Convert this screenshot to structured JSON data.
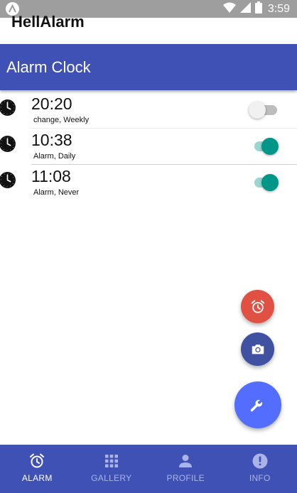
{
  "status_bar": {
    "time": "3:59"
  },
  "app": {
    "title": "HellAlarm"
  },
  "toolbar": {
    "title": "Alarm Clock"
  },
  "alarms": [
    {
      "time": "20:20",
      "detail": "change, Weekly",
      "enabled": false
    },
    {
      "time": "10:38",
      "detail": "Alarm, Daily",
      "enabled": true
    },
    {
      "time": "11:08",
      "detail": "Alarm, Never",
      "enabled": true
    }
  ],
  "fabs": [
    {
      "icon": "alarm-clock-icon",
      "color": "#e05144"
    },
    {
      "icon": "camera-icon",
      "color": "#3f51a0"
    },
    {
      "icon": "wrench-icon",
      "color": "#536dfe"
    }
  ],
  "bottom_nav": {
    "items": [
      {
        "label": "ALARM",
        "icon": "alarm-clock-icon",
        "active": true
      },
      {
        "label": "GALLERY",
        "icon": "grid-icon",
        "active": false
      },
      {
        "label": "PROFILE",
        "icon": "person-icon",
        "active": false
      },
      {
        "label": "INFO",
        "icon": "info-icon",
        "active": false
      }
    ]
  },
  "colors": {
    "primary": "#3f51b5",
    "toggle_on": "#009688",
    "fab_alarm": "#e05144",
    "fab_main": "#536dfe"
  }
}
